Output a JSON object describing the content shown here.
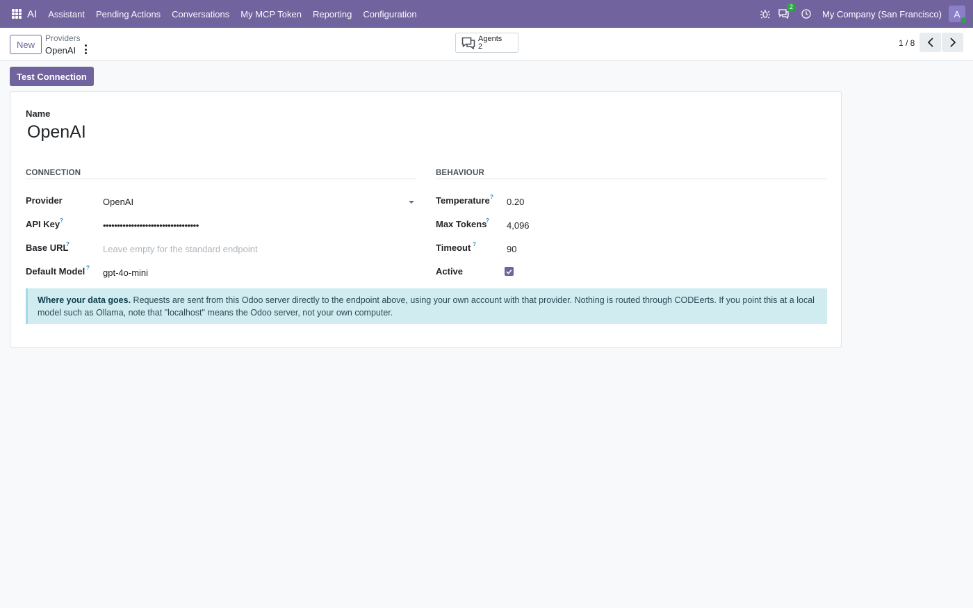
{
  "navbar": {
    "brand": "AI",
    "menu": [
      "Assistant",
      "Pending Actions",
      "Conversations",
      "My MCP Token",
      "Reporting",
      "Configuration"
    ],
    "messages_badge": "2",
    "company": "My Company (San Francisco)",
    "avatar_initial": "A"
  },
  "control_panel": {
    "new_label": "New",
    "breadcrumb_parent": "Providers",
    "breadcrumb_current": "OpenAI",
    "smart_button": {
      "label": "Agents",
      "value": "2"
    },
    "pager": "1 / 8"
  },
  "actions": {
    "test_connection": "Test Connection"
  },
  "form": {
    "name_label": "Name",
    "name_value": "OpenAI",
    "connection": {
      "title": "CONNECTION",
      "provider_label": "Provider",
      "provider_value": "OpenAI",
      "api_key_label": "API Key",
      "api_key_value": "••••••••••••••••••••••••••••••••••",
      "base_url_label": "Base URL",
      "base_url_placeholder": "Leave empty for the standard endpoint",
      "default_model_label": "Default Model",
      "default_model_value": "gpt-4o-mini"
    },
    "behaviour": {
      "title": "BEHAVIOUR",
      "temperature_label": "Temperature",
      "temperature_value": "0.20",
      "max_tokens_label": "Max Tokens",
      "max_tokens_value": "4,096",
      "timeout_label": "Timeout",
      "timeout_value": "90",
      "active_label": "Active",
      "active_checked": true
    },
    "help_mark": "?",
    "alert": {
      "bold": "Where your data goes.",
      "text": " Requests are sent from this Odoo server directly to the endpoint above, using your own account with that provider. Nothing is routed through CODEerts. If you point this at a local model such as Ollama, note that \"localhost\" means the Odoo server, not your own computer."
    }
  },
  "colors": {
    "brand": "#71639e",
    "alert_bg": "#d1ecf1",
    "badge": "#28a745"
  }
}
